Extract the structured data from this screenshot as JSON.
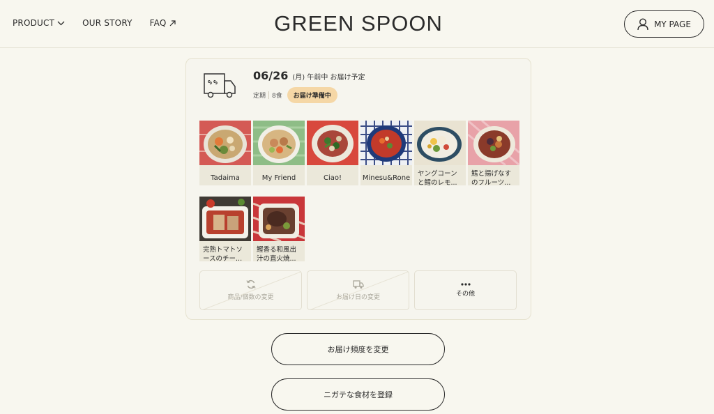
{
  "header": {
    "nav": [
      {
        "label": "PRODUCT",
        "icon": "chevron-down-icon"
      },
      {
        "label": "OUR STORY"
      },
      {
        "label": "FAQ",
        "icon": "external-arrow-icon"
      }
    ],
    "logo": "GREEN SPOON",
    "mypage_label": "MY PAGE"
  },
  "delivery": {
    "date": "06/26",
    "date_sub": "(月) 午前中 お届け予定",
    "plan": "定期",
    "count": "8食",
    "status": "お届け準備中",
    "status_color": "#f5d7a6"
  },
  "items": [
    {
      "name": "Tadaima"
    },
    {
      "name": "My Friend"
    },
    {
      "name": "Ciao!"
    },
    {
      "name": "Minesu&Rone"
    },
    {
      "name": "ヤングコーンと鱈のレモ..."
    },
    {
      "name": "鱈と揚げなすのフルーツ..."
    },
    {
      "name": "完熟トマトソースのチー..."
    },
    {
      "name": "鰹香る和風出汁の直火焼..."
    }
  ],
  "actions": [
    {
      "label": "商品/個数の変更",
      "icon": "refresh-icon"
    },
    {
      "label": "お届け日の変更",
      "icon": "truck-icon"
    },
    {
      "label": "その他",
      "icon": "more-icon"
    }
  ],
  "buttons": {
    "frequency": "お届け頻度を変更",
    "dislikes": "ニガテな食材を登録"
  }
}
